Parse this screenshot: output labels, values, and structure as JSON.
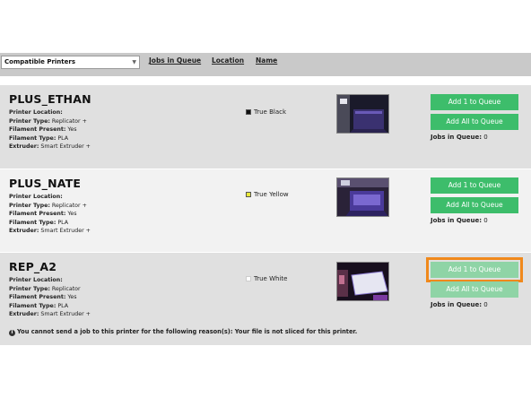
{
  "toolbar": {
    "filter_select": "Compatible Printers",
    "sort_links": [
      "Jobs in Queue",
      "Location",
      "Name"
    ]
  },
  "printers": [
    {
      "name": "PLUS_ETHAN",
      "props": [
        {
          "label": "Printer Location:",
          "value": ""
        },
        {
          "label": "Printer Type:",
          "value": "Replicator +"
        },
        {
          "label": "Filament Present:",
          "value": "Yes"
        },
        {
          "label": "Filament Type:",
          "value": "PLA"
        },
        {
          "label": "Extruder:",
          "value": "Smart Extruder +"
        }
      ],
      "filament_color": "True Black",
      "swatch_color": "#111111",
      "add_one": "Add 1 to Queue",
      "add_all": "Add All to Queue",
      "jobs_label": "Jobs in Queue:",
      "jobs_count": "0"
    },
    {
      "name": "PLUS_NATE",
      "props": [
        {
          "label": "Printer Location:",
          "value": ""
        },
        {
          "label": "Printer Type:",
          "value": "Replicator +"
        },
        {
          "label": "Filament Present:",
          "value": "Yes"
        },
        {
          "label": "Filament Type:",
          "value": "PLA"
        },
        {
          "label": "Extruder:",
          "value": "Smart Extruder +"
        }
      ],
      "filament_color": "True Yellow",
      "swatch_color": "#e8e83a",
      "add_one": "Add 1 to Queue",
      "add_all": "Add All to Queue",
      "jobs_label": "Jobs in Queue:",
      "jobs_count": "0"
    },
    {
      "name": "REP_A2",
      "props": [
        {
          "label": "Printer Location:",
          "value": ""
        },
        {
          "label": "Printer Type:",
          "value": "Replicator"
        },
        {
          "label": "Filament Present:",
          "value": "Yes"
        },
        {
          "label": "Filament Type:",
          "value": "PLA"
        },
        {
          "label": "Extruder:",
          "value": "Smart Extruder +"
        }
      ],
      "filament_color": "True White",
      "swatch_color": "#ffffff",
      "add_one": "Add 1 to Queue",
      "add_all": "Add All to Queue",
      "jobs_label": "Jobs in Queue:",
      "jobs_count": "0",
      "warning": "You cannot send a job to this printer for the following reason(s): Your file is not sliced for this printer."
    }
  ],
  "colors": {
    "button_green": "#3dbd6b",
    "button_disabled": "#8fd4a6",
    "highlight_orange": "#f0891c"
  }
}
